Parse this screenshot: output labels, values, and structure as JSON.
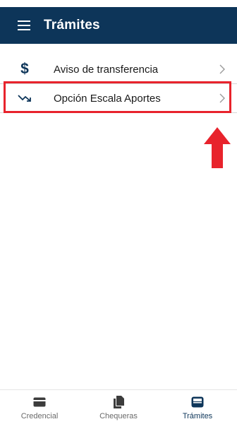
{
  "header": {
    "title": "Trámites"
  },
  "menu": {
    "items": [
      {
        "icon": "dollar-icon",
        "glyph": "$",
        "label": "Aviso de transferencia"
      },
      {
        "icon": "trending-down-icon",
        "label": "Opción Escala Aportes"
      }
    ]
  },
  "bottom_nav": {
    "tabs": [
      {
        "icon": "card-icon",
        "label": "Credencial",
        "active": false
      },
      {
        "icon": "documents-icon",
        "label": "Chequeras",
        "active": false
      },
      {
        "icon": "inbox-tray-icon",
        "label": "Trámites",
        "active": true
      }
    ]
  },
  "colors": {
    "primary": "#0d3559",
    "highlight": "#e8232c",
    "inactive": "#6a6a6a",
    "divider": "#d6d6d6"
  }
}
